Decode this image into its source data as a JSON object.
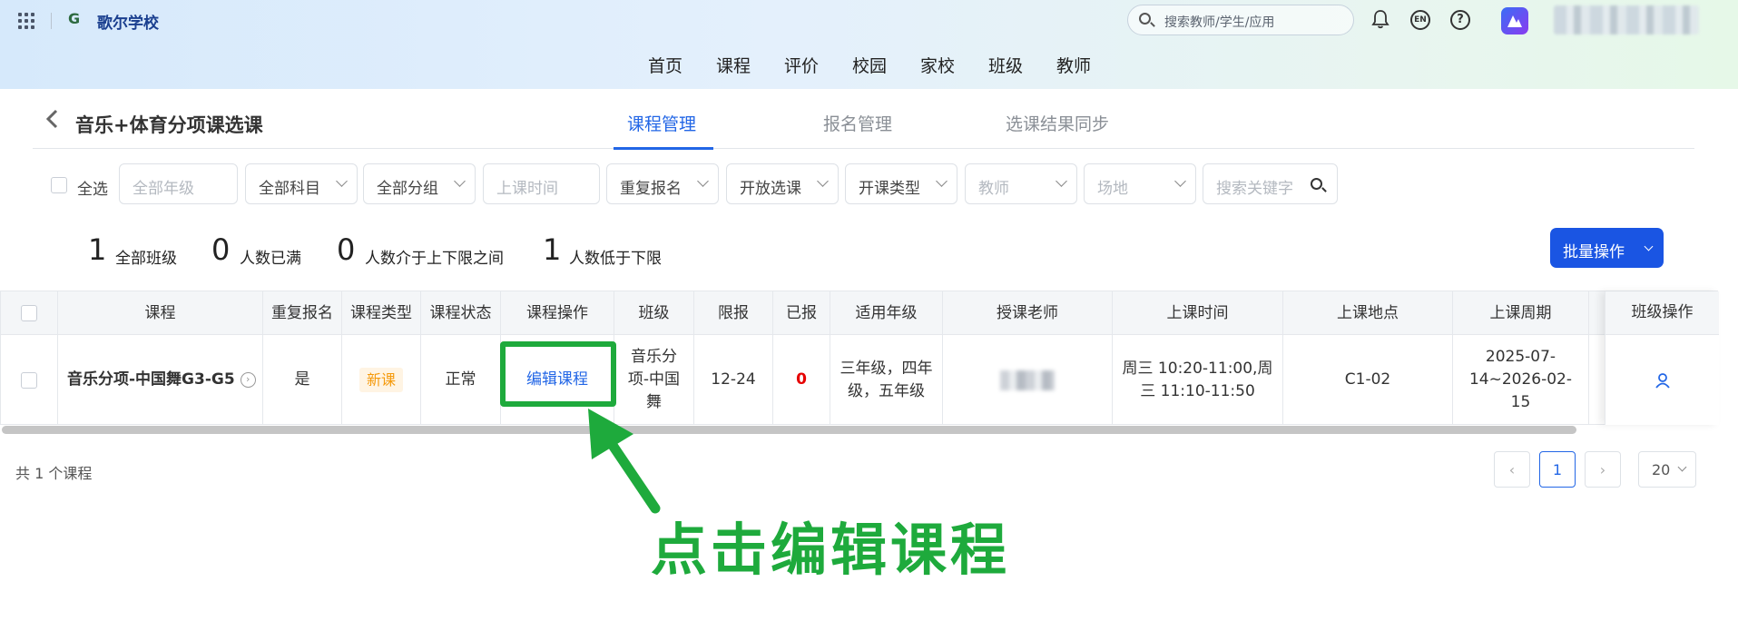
{
  "header": {
    "logo_text": "G",
    "school_name": "歌尔学校",
    "search_placeholder": "搜索教师/学生/应用",
    "lang_badge": "EN",
    "help_symbol": "?"
  },
  "main_nav": [
    "首页",
    "课程",
    "评价",
    "校园",
    "家校",
    "班级",
    "教师"
  ],
  "page": {
    "title": "音乐+体育分项课选课",
    "tabs": [
      {
        "label": "课程管理",
        "active": true
      },
      {
        "label": "报名管理",
        "active": false
      },
      {
        "label": "选课结果同步",
        "active": false
      }
    ]
  },
  "filters": {
    "select_all": "全选",
    "items": [
      {
        "label": "全部年级",
        "placeholder": true
      },
      {
        "label": "全部科目",
        "placeholder": false
      },
      {
        "label": "全部分组",
        "placeholder": false
      },
      {
        "label": "上课时间",
        "placeholder": true
      },
      {
        "label": "重复报名",
        "placeholder": false
      },
      {
        "label": "开放选课",
        "placeholder": false
      },
      {
        "label": "开课类型",
        "placeholder": false
      },
      {
        "label": "教师",
        "placeholder": true
      },
      {
        "label": "场地",
        "placeholder": true
      }
    ],
    "search_placeholder": "搜索关键字"
  },
  "stats": [
    {
      "value": "1",
      "label": "全部班级"
    },
    {
      "value": "0",
      "label": "人数已满"
    },
    {
      "value": "0",
      "label": "人数介于上下限之间"
    },
    {
      "value": "1",
      "label": "人数低于下限"
    }
  ],
  "batch_button": "批量操作",
  "table": {
    "headers": [
      "课程",
      "重复报名",
      "课程类型",
      "课程状态",
      "课程操作",
      "班级",
      "限报",
      "已报",
      "适用年级",
      "授课老师",
      "上课时间",
      "上课地点",
      "上课周期",
      "班级操作"
    ],
    "rows": [
      {
        "course": "音乐分项-中国舞G3-G5",
        "repeat": "是",
        "type": "新课",
        "status": "正常",
        "action": "编辑课程",
        "class_name": "音乐分项-中国舞",
        "limit": "12-24",
        "enrolled": "0",
        "grades": "三年级，四年级，五年级",
        "time": "周三 10:20-11:00,周三 11:10-11:50",
        "location": "C1-02",
        "period": "2025-07-14~2026-02-15"
      }
    ]
  },
  "pagination": {
    "total": "共 1 个课程",
    "current_page": "1",
    "page_size": "20"
  },
  "annotation": {
    "text": "点击编辑课程",
    "color": "#1eaa3c"
  }
}
